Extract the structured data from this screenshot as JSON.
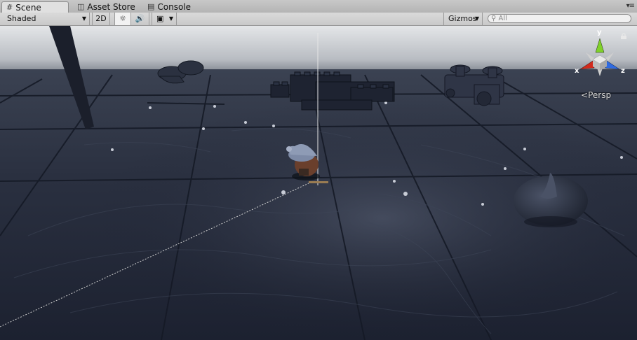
{
  "tabs": [
    {
      "label": "Scene",
      "icon": "grid-icon"
    },
    {
      "label": "Asset Store",
      "icon": "shopping-bag-icon"
    },
    {
      "label": "Console",
      "icon": "console-icon"
    }
  ],
  "toolbar": {
    "shading_mode": "Shaded",
    "mode_2d_label": "2D",
    "gizmos_label": "Gizmos",
    "search_placeholder": "All"
  },
  "scene": {
    "projection_label": "Persp",
    "axes": {
      "x": "x",
      "y": "y",
      "z": "z"
    }
  },
  "colors": {
    "axis_x": "#d22a1c",
    "axis_y": "#80d12a",
    "axis_z": "#2f6ae0",
    "floor": "#252b3a",
    "sky": "#c8ccd0"
  }
}
